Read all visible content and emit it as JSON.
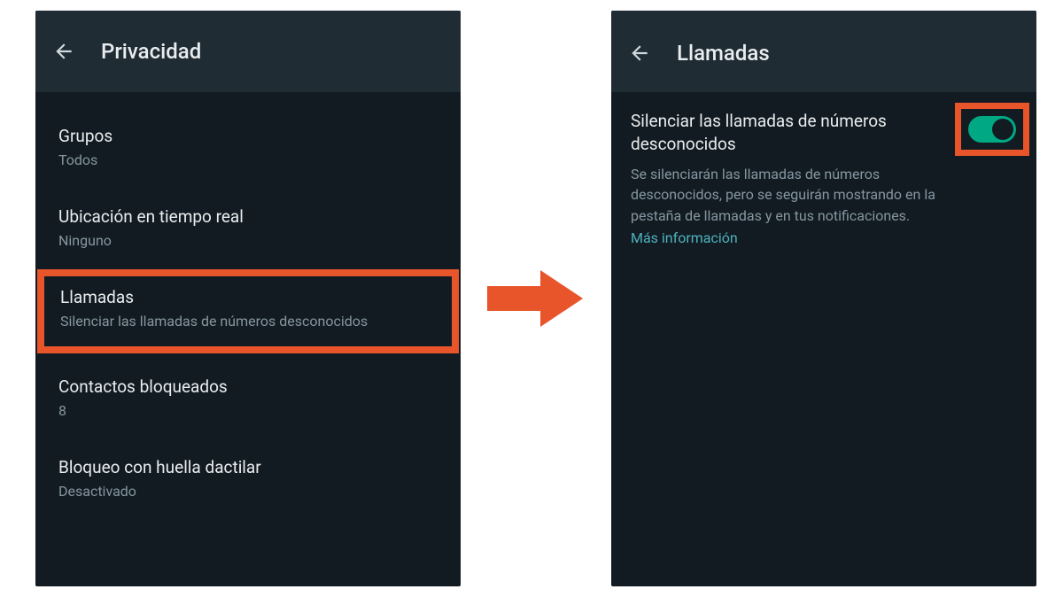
{
  "left": {
    "title": "Privacidad",
    "items": [
      {
        "title": "Grupos",
        "sub": "Todos",
        "highlighted": false
      },
      {
        "title": "Ubicación en tiempo real",
        "sub": "Ninguno",
        "highlighted": false
      },
      {
        "title": "Llamadas",
        "sub": "Silenciar las llamadas de números desconocidos",
        "highlighted": true
      },
      {
        "title": "Contactos bloqueados",
        "sub": "8",
        "highlighted": false
      },
      {
        "title": "Bloqueo con huella dactilar",
        "sub": "Desactivado",
        "highlighted": false
      }
    ]
  },
  "right": {
    "title": "Llamadas",
    "setting_title": "Silenciar las llamadas de números desconocidos",
    "setting_desc": "Se silenciarán las llamadas de números desconocidos, pero se seguirán mostrando en la pestaña de llamadas y en tus notificaciones.",
    "link": "Más información",
    "toggle_on": true
  },
  "colors": {
    "highlight": "#e8552b",
    "accent": "#00a884"
  }
}
